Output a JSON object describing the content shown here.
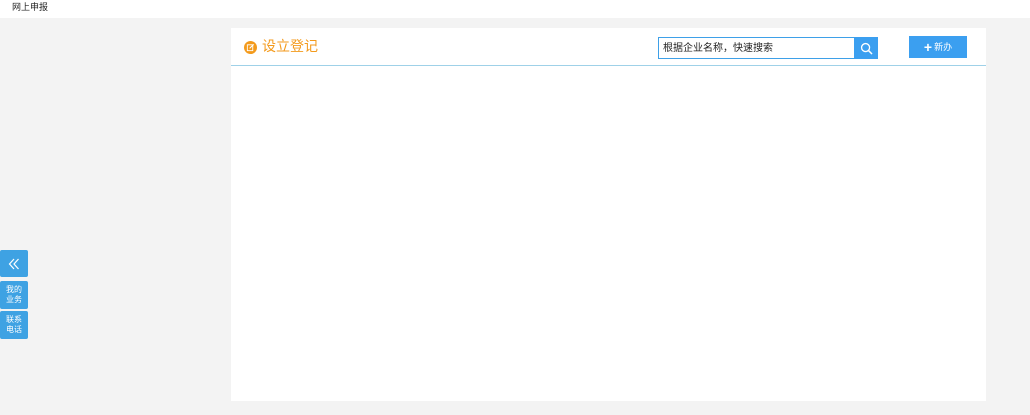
{
  "header": {
    "title": "网上申报"
  },
  "panel": {
    "title": "设立登记",
    "accent_color": "#f39a1c",
    "search": {
      "placeholder": "根据企业名称，快速搜索"
    },
    "add_button": {
      "plus": "+",
      "label": "新办"
    }
  },
  "sidebar": {
    "collapse_glyph": "«",
    "my_business": {
      "line1": "我的",
      "line2": "业务"
    },
    "contact_phone": {
      "line1": "联系",
      "line2": "电话"
    }
  },
  "colors": {
    "primary": "#3b9ff0",
    "accent": "#f39a1c",
    "background": "#f3f3f3"
  }
}
